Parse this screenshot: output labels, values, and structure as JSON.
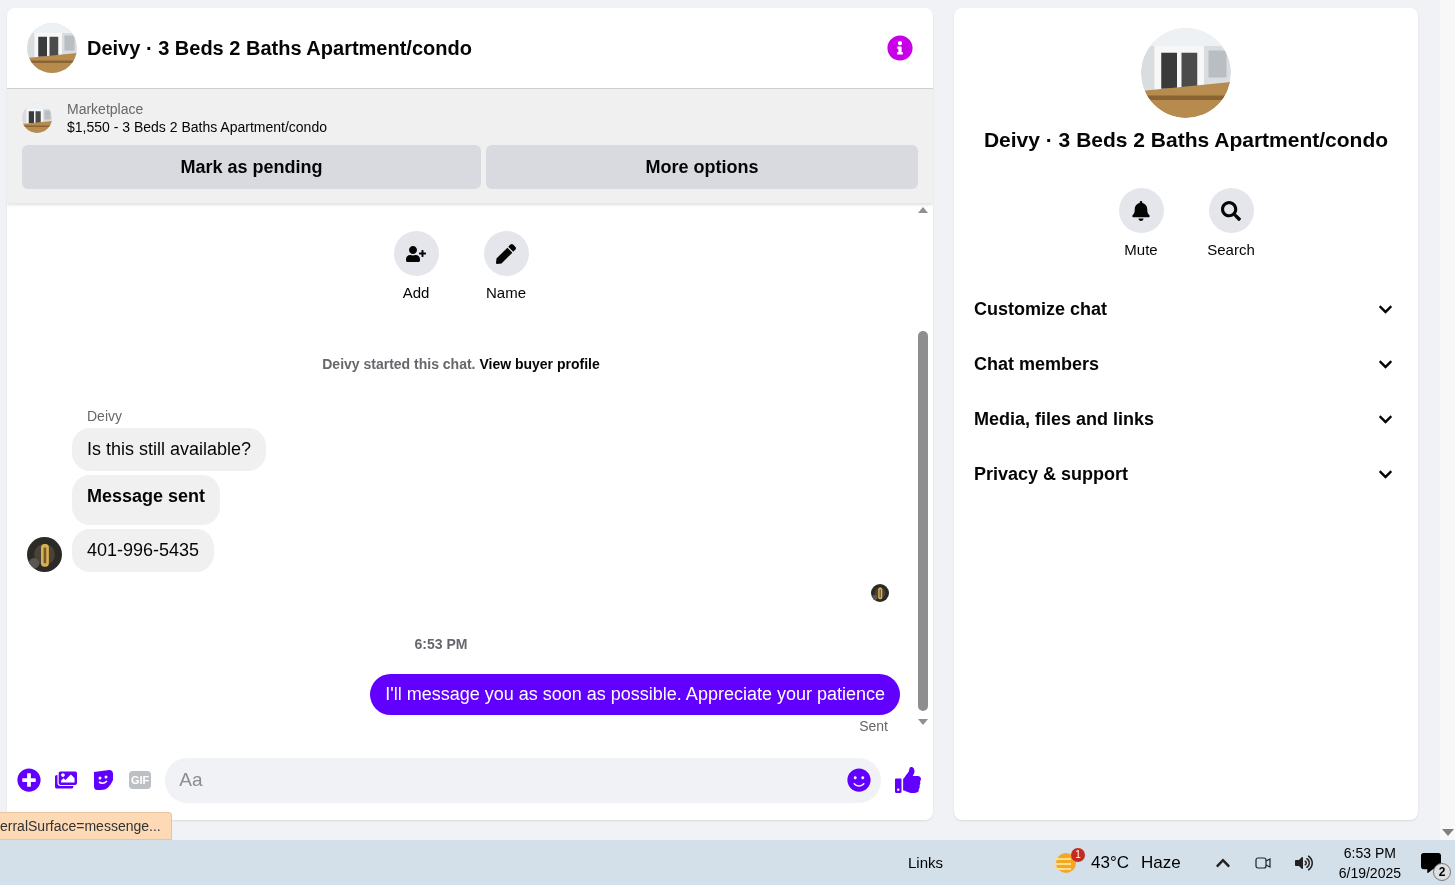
{
  "chat": {
    "title": "Deivy · 3 Beds 2 Baths Apartment/condo",
    "listing": {
      "source": "Marketplace",
      "summary": "$1,550 - 3 Beds 2 Baths Apartment/condo"
    },
    "listing_buttons": [
      "Mark as pending",
      "More options"
    ],
    "quick_actions": [
      {
        "kind": "add",
        "label": "Add"
      },
      {
        "kind": "name",
        "label": "Name"
      }
    ],
    "started_notice": {
      "text": "Deivy started this chat.",
      "link": "View buyer profile"
    },
    "incoming": {
      "sender": "Deivy",
      "bubbles": [
        {
          "kind": "text",
          "text": "Is this still available?"
        },
        {
          "kind": "bold",
          "text": "Message sent"
        },
        {
          "kind": "text",
          "text": "401-996-5435"
        }
      ]
    },
    "time": "6:53 PM",
    "outgoing": {
      "text": "I'll message you as soon as possible. Appreciate your patience",
      "status": "Sent"
    },
    "composer": {
      "placeholder": "Aa",
      "gif_label": "GIF"
    }
  },
  "details": {
    "title": "Deivy · 3 Beds 2 Baths Apartment/condo",
    "actions": [
      {
        "kind": "mute",
        "label": "Mute"
      },
      {
        "kind": "search",
        "label": "Search"
      }
    ],
    "sections": [
      {
        "label": "Customize chat",
        "expanded": false
      },
      {
        "label": "Chat members",
        "expanded": false
      },
      {
        "label": "Media, files and links",
        "expanded": false
      },
      {
        "label": "Privacy & support",
        "expanded": false
      }
    ]
  },
  "status_link": "erralSurface=messenge...",
  "taskbar": {
    "links": "Links",
    "weather_badge": "1",
    "temperature": "43°C",
    "condition": "Haze",
    "time": "6:53 PM",
    "date": "6/19/2025",
    "notification_count": "2"
  }
}
